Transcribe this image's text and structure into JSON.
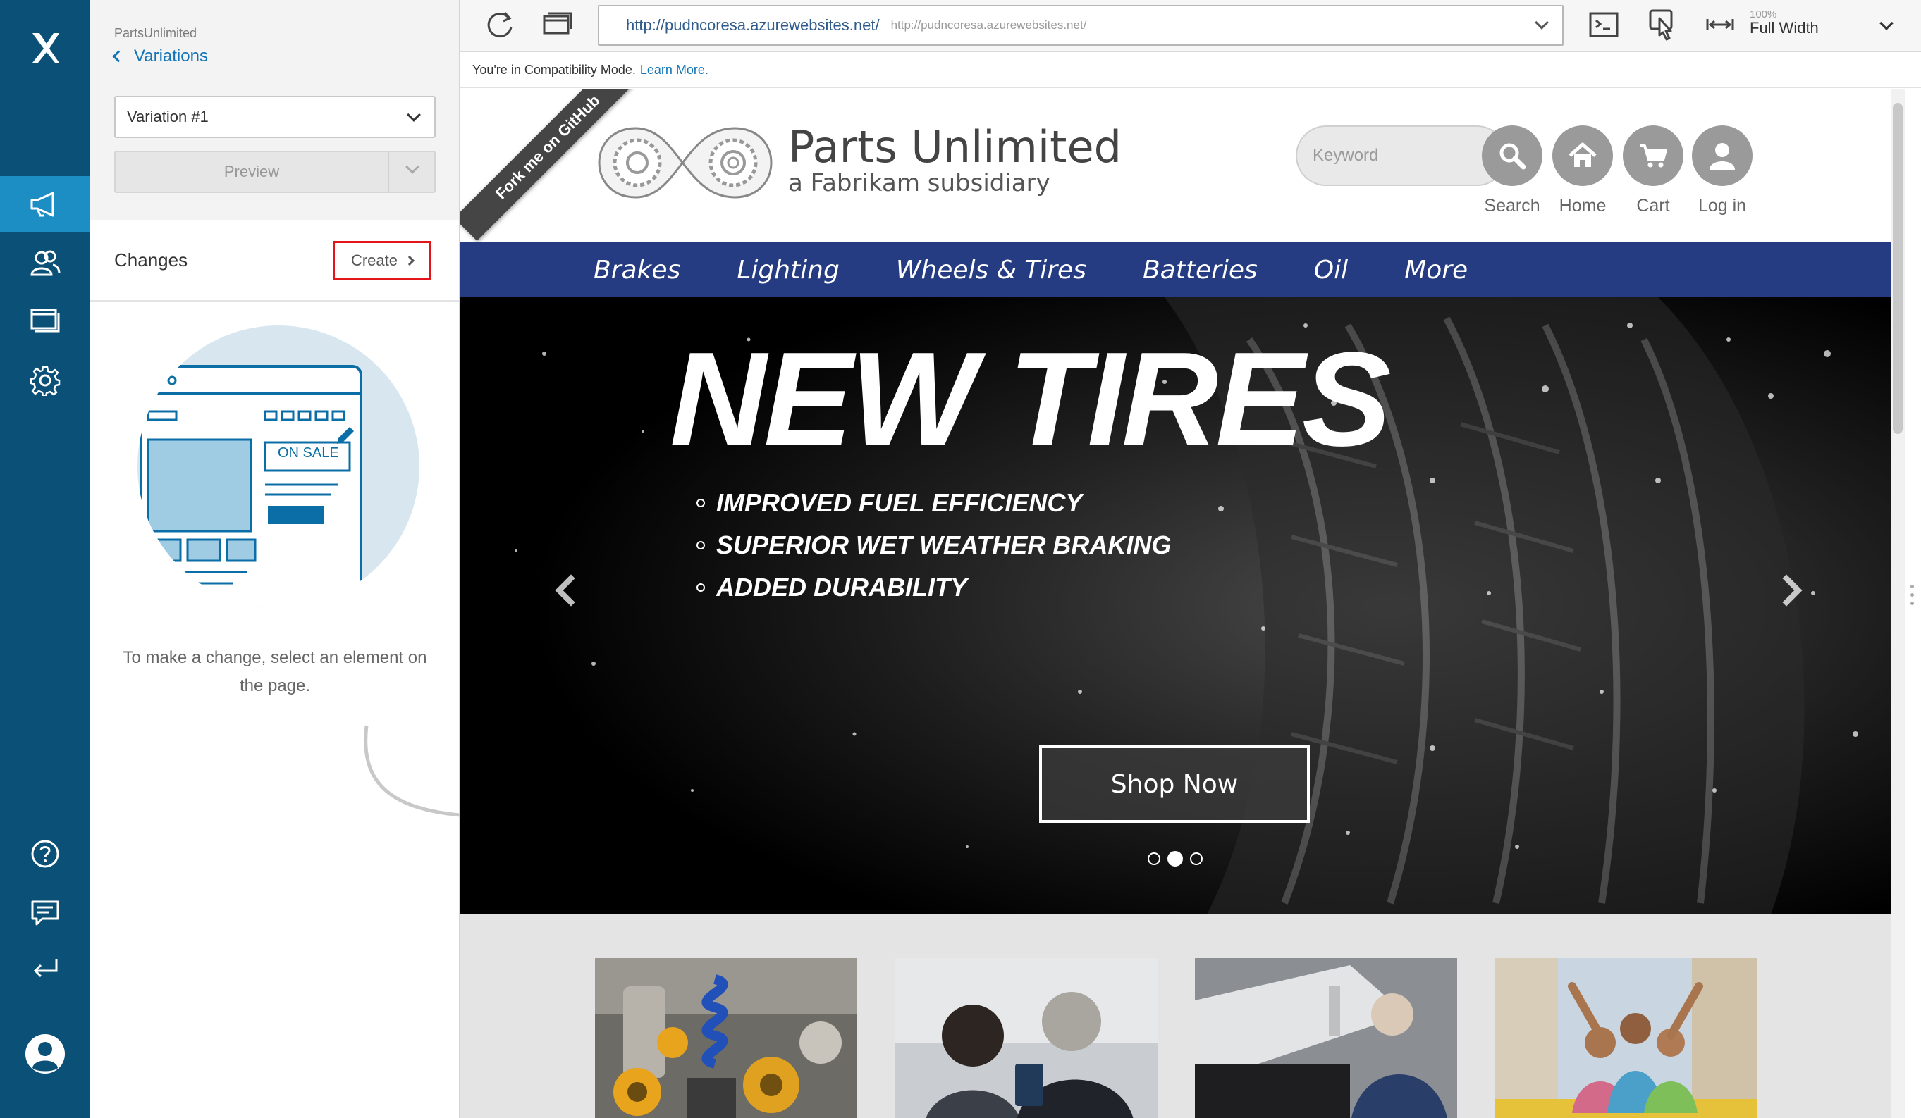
{
  "panel": {
    "breadcrumb": "PartsUnlimited",
    "back_label": "Variations",
    "variation_selected": "Variation #1",
    "preview_label": "Preview",
    "changes_title": "Changes",
    "create_label": "Create",
    "illustration_badge": "ON SALE",
    "hint": "To make a change, select an element on the page."
  },
  "browser": {
    "url": "http://pudncoresa.azurewebsites.net/",
    "url_secondary": "http://pudncoresa.azurewebsites.net/",
    "zoom_percent": "100%",
    "width_mode": "Full Width",
    "compat_text": "You're in Compatibility Mode.",
    "compat_link": "Learn More."
  },
  "site": {
    "ribbon": "Fork me on GitHub",
    "brand": "Parts Unlimited",
    "tagline": "a Fabrikam subsidiary",
    "search_placeholder": "Keyword",
    "header_buttons": [
      "Search",
      "Home",
      "Cart",
      "Log in"
    ],
    "nav": [
      "Brakes",
      "Lighting",
      "Wheels & Tires",
      "Batteries",
      "Oil",
      "More"
    ],
    "hero": {
      "title": "NEW TIRES",
      "bullets": [
        "IMPROVED FUEL EFFICIENCY",
        "SUPERIOR WET WEATHER BRAKING",
        "ADDED DURABILITY"
      ],
      "cta": "Shop Now",
      "active_slide": 2,
      "slide_count": 3
    }
  },
  "colors": {
    "rail": "#0b5076",
    "rail_active": "#1d8ec4",
    "nav_bar": "#253c82",
    "create_highlight": "#e3151a",
    "link": "#1274b4"
  }
}
